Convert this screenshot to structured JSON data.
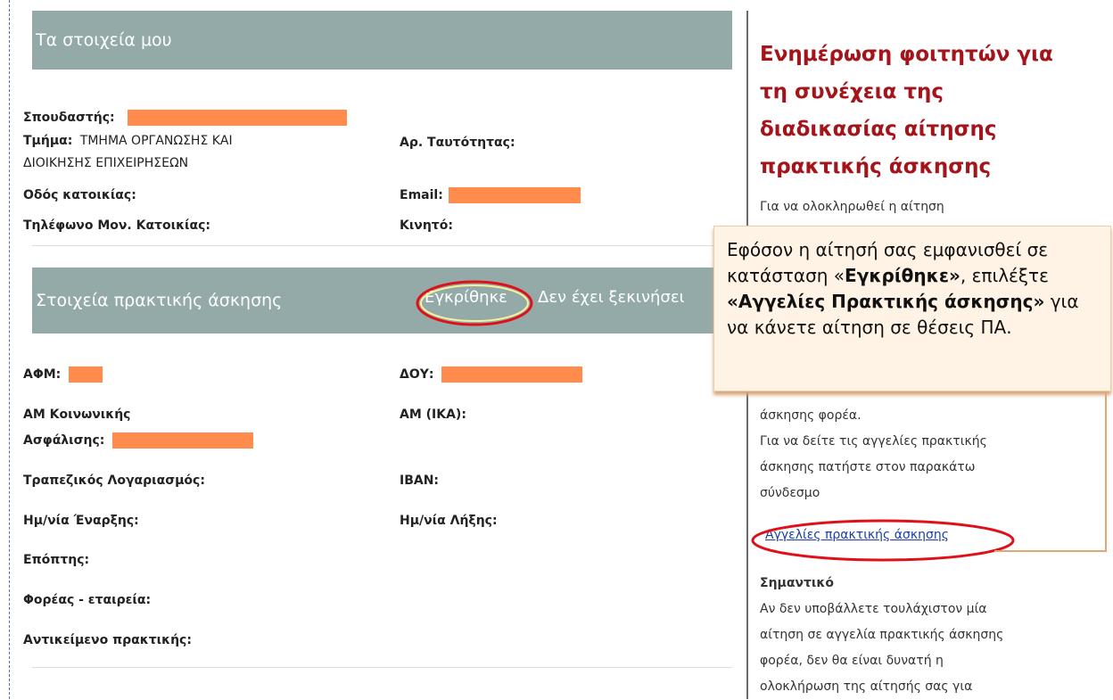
{
  "panel1": {
    "title": "Τα στοιχεία μου",
    "student_label": "Σπουδαστής:",
    "dept_label": "Τμήμα:",
    "dept_value_line1": "ΤΜΗΜΑ ΟΡΓΑΝΩΣΗΣ ΚΑΙ",
    "dept_value_line2": "ΔΙΟΙΚΗΣΗΣ ΕΠΙΧΕΙΡΗΣΕΩΝ",
    "id_label": "Αρ. Ταυτότητας:",
    "address_label": "Οδός κατοικίας:",
    "email_label": "Email:",
    "phone_label": "Τηλέφωνο Μον. Κατοικίας:",
    "mobile_label": "Κινητό:"
  },
  "panel2": {
    "title": "Στοιχεία πρακτικής άσκησης",
    "status_approved": "Εγκρίθηκε",
    "status_not_started": "Δεν έχει ξεκινήσει",
    "afm_label": "ΑΦΜ:",
    "doy_label": "ΔΟΥ:",
    "am_social_line1": "ΑΜ Κοινωνικής",
    "am_social_line2": "Ασφάλισης:",
    "am_ika_label": "ΑΜ (ΙΚΑ):",
    "bank_label": "Τραπεζικός Λογαριασμός:",
    "iban_label": "IBAN:",
    "start_label": "Ημ/νία Έναρξης:",
    "end_label": "Ημ/νία Λήξης:",
    "supervisor_label": "Επόπτης:",
    "company_label": "Φορέας - εταιρεία:",
    "subject_label": "Αντικείμενο πρακτικής:"
  },
  "sidebar": {
    "title": "Ενημέρωση φοιτητών για τη συνέχεια της διαδικασίας αίτησης πρακτικής άσκησης",
    "intro": "Για να ολοκληρωθεί η αίτηση",
    "text1_line1": "άσκησης φορέα.",
    "text1_line2": "Για να δείτε τις αγγελίες πρακτικής",
    "text1_line3": "άσκησης πατήστε στον παρακάτω",
    "text1_line4": "σύνδεσμο",
    "link": "Αγγελίες πρακτικής άσκησης",
    "important_heading": "Σημαντικό",
    "important_line1": "Αν δεν υποβάλλετε τουλάχιστον μία",
    "important_line2": "αίτηση σε αγγελία πρακτικής άσκησης",
    "important_line3": "φορέα, δεν θα είναι δυνατή η",
    "important_line4": "ολοκλήρωση της αίτησής σας για"
  },
  "callout": {
    "part1": "Εφόσον η αίτησή σας εμφανισθεί σε κατάσταση «",
    "bold1": "Εγκρίθηκε»",
    "part2": ", επιλέξτε ",
    "bold2": "«Αγγελίες Πρακτικής άσκησης»",
    "part3": " για να κάνετε αίτηση σε θέσεις ΠΑ."
  },
  "colors": {
    "header_bg": "#93aaa9",
    "redaction": "#ff8c4d",
    "sidebar_title": "#a3151b",
    "link": "#1a3fa6",
    "annotation_ellipse": "#e0101a"
  }
}
